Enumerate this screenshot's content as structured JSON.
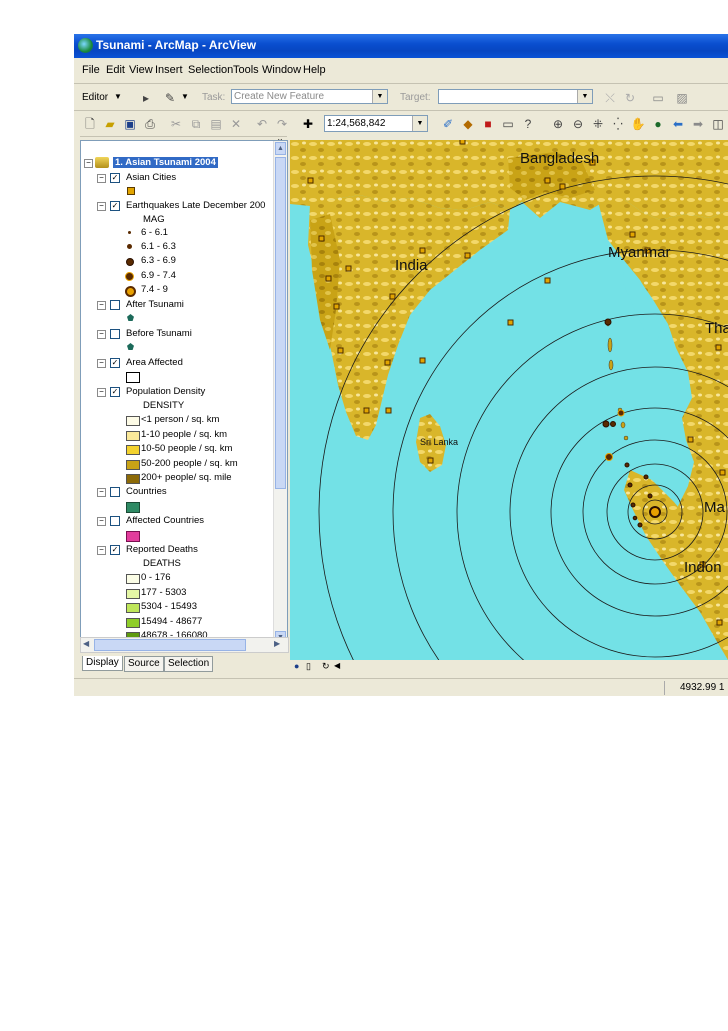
{
  "window": {
    "title": "Tsunami - ArcMap - ArcView"
  },
  "menu": [
    "File",
    "Edit",
    "View",
    "Insert",
    "Selection",
    "Tools",
    "Window",
    "Help"
  ],
  "editor_toolbar": {
    "editor_label": "Editor",
    "task_label": "Task:",
    "task_value": "Create New Feature",
    "target_label": "Target:",
    "target_value": ""
  },
  "standard_toolbar": {
    "scale": "1:24,568,842"
  },
  "toc": {
    "data_frame": "1. Asian Tsunami 2004",
    "layers": [
      {
        "name": "Asian Cities",
        "checked": true
      },
      {
        "name": "Earthquakes Late December 200",
        "checked": true,
        "field": "MAG",
        "classes": [
          "6 - 6.1",
          "6.1 - 6.3",
          "6.3 - 6.9",
          "6.9 - 7.4",
          "7.4 - 9"
        ]
      },
      {
        "name": "After Tsunami",
        "checked": false
      },
      {
        "name": "Before Tsunami",
        "checked": false
      },
      {
        "name": "Area Affected",
        "checked": true
      },
      {
        "name": "Population Density",
        "checked": true,
        "field": "DENSITY",
        "classes": [
          "<1 person / sq. km",
          "1-10 people / sq. km",
          "10-50 people / sq. km",
          "50-200 people / sq. km",
          "200+ people/ sq. mile"
        ],
        "colors": [
          "#fdfbe6",
          "#fbe99a",
          "#f3d22e",
          "#c9a316",
          "#8c6a08"
        ]
      },
      {
        "name": "Countries",
        "checked": false,
        "color": "#2e8a64"
      },
      {
        "name": "Affected Countries",
        "checked": false,
        "color": "#e23d9c"
      },
      {
        "name": "Reported Deaths",
        "checked": true,
        "field": "DEATHS",
        "classes": [
          "0 - 176",
          "177 - 5303",
          "5304 - 15493",
          "15494 - 48677",
          "48678 - 166080"
        ],
        "colors": [
          "#fbfde6",
          "#e5f7a6",
          "#bfe65a",
          "#8fcd2a",
          "#5e9a10"
        ]
      }
    ]
  },
  "tabs": [
    "Display",
    "Source",
    "Selection"
  ],
  "map": {
    "labels": [
      "Bangladesh",
      "India",
      "Myanmar",
      "Tha",
      "Sri Lanka",
      "Ma",
      "Indon"
    ],
    "water_color": "#73e1e6",
    "land_color": "#d9b62a"
  },
  "status": {
    "coordinates": "4932.99  1"
  }
}
